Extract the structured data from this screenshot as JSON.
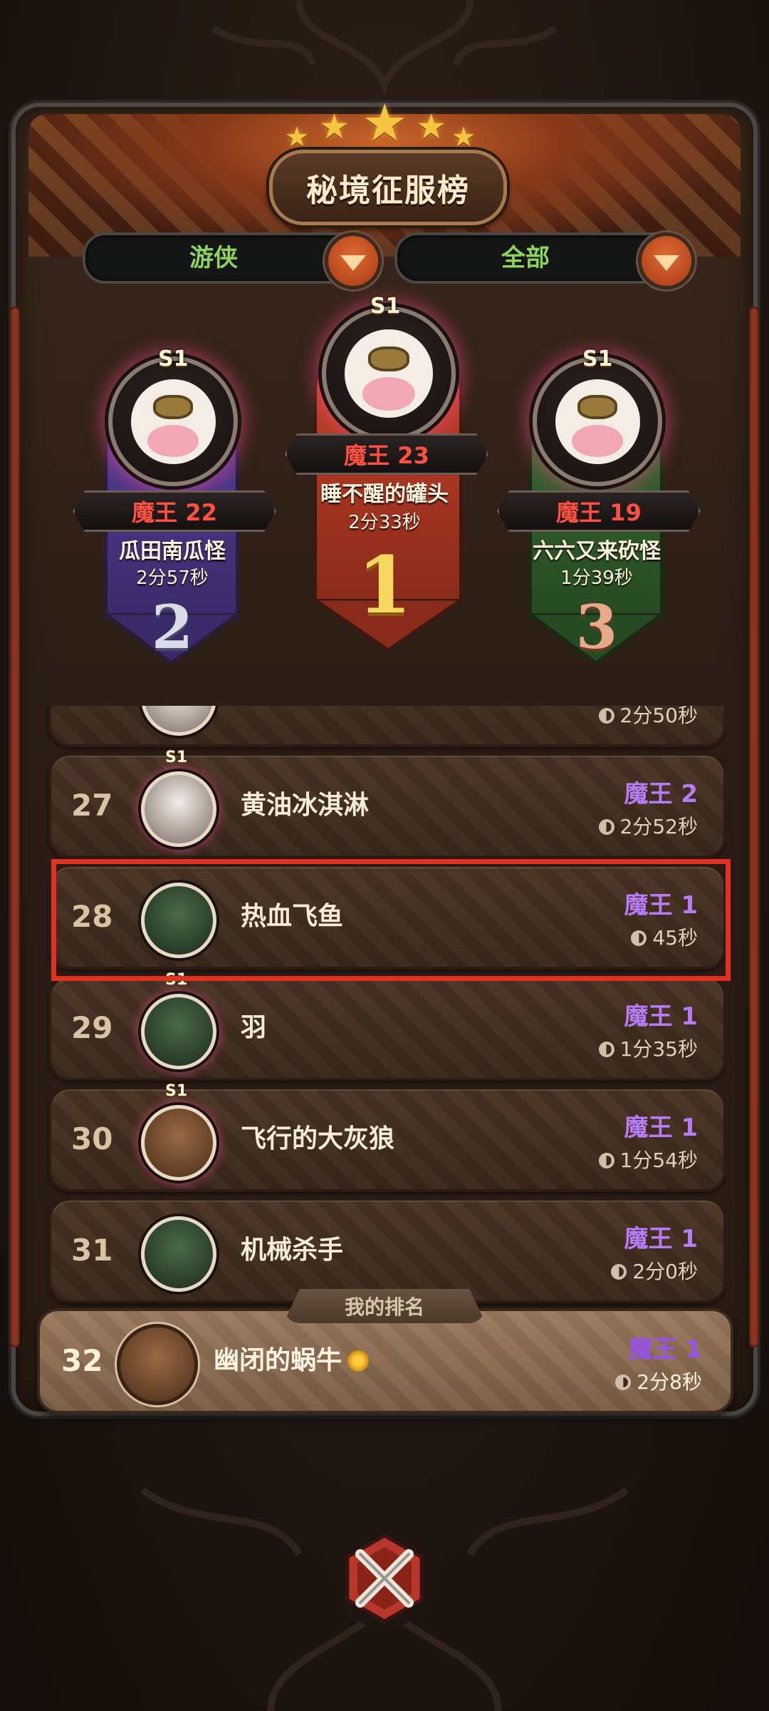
{
  "header": {
    "title": "秘境征服榜"
  },
  "filters": {
    "class_label": "游侠",
    "scope_label": "全部"
  },
  "podium": [
    {
      "rank": "1",
      "badge": "S1",
      "level": "魔王 23",
      "name": "睡不醒的罐头",
      "time": "2分33秒"
    },
    {
      "rank": "2",
      "badge": "S1",
      "level": "魔王 22",
      "name": "瓜田南瓜怪",
      "time": "2分57秒"
    },
    {
      "rank": "3",
      "badge": "S1",
      "level": "魔王 19",
      "name": "六六又来砍怪",
      "time": "1分39秒"
    }
  ],
  "list": {
    "partial_row_time": "2分50秒",
    "rows": [
      {
        "rank": "27",
        "badge": "S1",
        "name": "黄油冰淇淋",
        "level": "魔王 2",
        "time": "2分52秒"
      },
      {
        "rank": "28",
        "badge": "",
        "name": "热血飞鱼",
        "level": "魔王 1",
        "time": "45秒"
      },
      {
        "rank": "29",
        "badge": "S1",
        "name": "羽",
        "level": "魔王 1",
        "time": "1分35秒"
      },
      {
        "rank": "30",
        "badge": "S1",
        "name": "飞行的大灰狼",
        "level": "魔王 1",
        "time": "1分54秒"
      },
      {
        "rank": "31",
        "badge": "",
        "name": "机械杀手",
        "level": "魔王 1",
        "time": "2分0秒"
      }
    ]
  },
  "my_rank": {
    "tag": "我的排名",
    "rank": "32",
    "name": "幽闭的蜗牛",
    "level": "魔王 1",
    "time": "2分8秒"
  },
  "colors": {
    "accent_red": "#e2311f",
    "level_purple": "#b77cf5",
    "filter_green": "#8fd45a",
    "gold": "#f5c542"
  },
  "icons": [
    "star-icon",
    "dropdown-arrow-icon",
    "clock-icon",
    "snail-icon",
    "close-icon"
  ]
}
